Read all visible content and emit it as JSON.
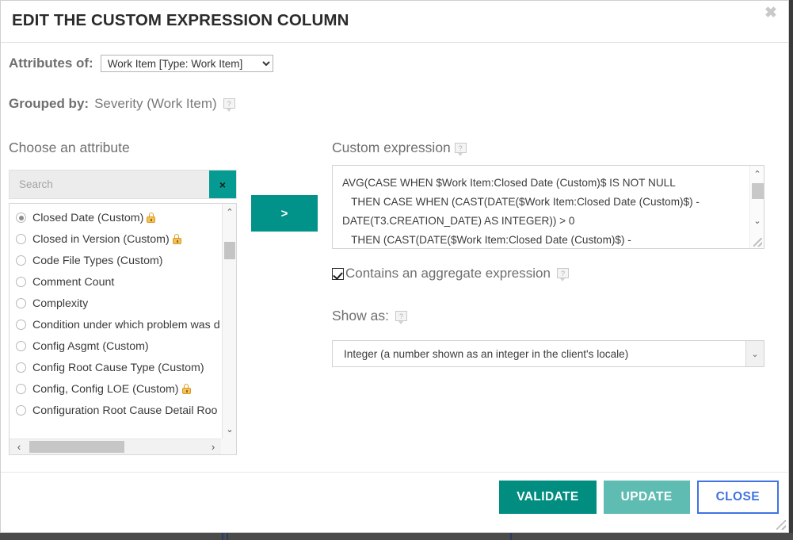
{
  "dialog": {
    "title": "EDIT THE CUSTOM EXPRESSION COLUMN",
    "close_icon": "close-icon",
    "close_glyph": "✖"
  },
  "attributes_of": {
    "label": "Attributes of:",
    "selected": "Work Item [Type: Work Item]",
    "options": [
      "Work Item [Type: Work Item]"
    ]
  },
  "grouped_by": {
    "label": "Grouped by:",
    "value": "Severity (Work Item)",
    "help_glyph": "?"
  },
  "choose_attribute": {
    "title": "Choose an attribute",
    "search": {
      "placeholder": "Search",
      "value": "",
      "clear_glyph": "×"
    },
    "items": [
      {
        "label": "Closed Date (Custom)",
        "selected": true,
        "locked": true
      },
      {
        "label": "Closed in Version (Custom)",
        "selected": false,
        "locked": true
      },
      {
        "label": "Code File Types (Custom)",
        "selected": false,
        "locked": false
      },
      {
        "label": "Comment Count",
        "selected": false,
        "locked": false
      },
      {
        "label": "Complexity",
        "selected": false,
        "locked": false
      },
      {
        "label": "Condition under which problem was d",
        "selected": false,
        "locked": false
      },
      {
        "label": "Config Asgmt (Custom)",
        "selected": false,
        "locked": false
      },
      {
        "label": "Config Root Cause Type (Custom)",
        "selected": false,
        "locked": false
      },
      {
        "label": "Config, Config LOE (Custom)",
        "selected": false,
        "locked": true
      },
      {
        "label": "Configuration Root Cause Detail  Roo",
        "selected": false,
        "locked": false
      }
    ],
    "scroll_up_glyph": "⌃",
    "scroll_down_glyph": "⌄",
    "scroll_left_glyph": "‹",
    "scroll_right_glyph": "›"
  },
  "move_button": {
    "label": ">",
    "name": "move-right-button"
  },
  "custom_expression": {
    "title": "Custom expression",
    "help_glyph": "?",
    "value": "AVG(CASE WHEN $Work Item:Closed Date (Custom)$ IS NOT NULL\n   THEN CASE WHEN (CAST(DATE($Work Item:Closed Date (Custom)$) -\nDATE(T3.CREATION_DATE) AS INTEGER)) > 0\n   THEN (CAST(DATE($Work Item:Closed Date (Custom)$) -",
    "scroll_up_glyph": "⌃",
    "scroll_down_glyph": "⌄"
  },
  "aggregate": {
    "label": "Contains an aggregate expression",
    "checked": true,
    "help_glyph": "?"
  },
  "show_as": {
    "label": "Show as:",
    "help_glyph": "?",
    "selected": "Integer (a number shown as an integer in the client's locale)",
    "arrow_glyph": "⌄"
  },
  "footer": {
    "validate_label": "VALIDATE",
    "update_label": "UPDATE",
    "close_label": "CLOSE"
  },
  "colors": {
    "teal_primary": "#018d80",
    "teal_light": "#5fbcb2",
    "teal_accent": "#019389",
    "link_blue": "#3f73e3",
    "lock_amber": "#f3c05a",
    "text_gray": "#6f6f6f"
  }
}
